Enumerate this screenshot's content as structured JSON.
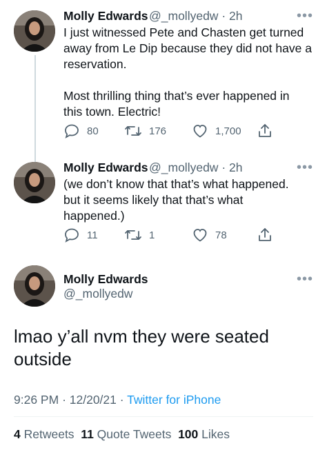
{
  "tweets": [
    {
      "name": "Molly Edwards",
      "handle": "@_mollyedw",
      "sep": "·",
      "time": "2h",
      "lines": [
        "I just witnessed Pete and Chasten get turned",
        "away from Le Dip because they did not have a",
        "reservation.",
        "",
        "Most thrilling thing that’s ever happened in",
        "this town. Electric!"
      ],
      "replies": "80",
      "retweets": "176",
      "likes": "1,700"
    },
    {
      "name": "Molly Edwards",
      "handle": "@_mollyedw",
      "sep": "·",
      "time": "2h",
      "lines": [
        "(we don’t know that that’s what happened.",
        "but it seems likely that that’s what",
        "happened.)"
      ],
      "replies": "11",
      "retweets": "1",
      "likes": "78"
    }
  ],
  "main": {
    "name": "Molly Edwards",
    "handle": "@_mollyedw",
    "lines": [
      "lmao y’all nvm they were seated",
      "outside"
    ],
    "time": "9:26 PM",
    "dot1": "·",
    "date": "12/20/21",
    "dot2": "·",
    "source": "Twitter for iPhone",
    "retweets_count": "4",
    "retweets_label": "Retweets",
    "quotes_count": "11",
    "quotes_label": "Quote Tweets",
    "likes_count": "100",
    "likes_label": "Likes"
  },
  "icons": {
    "more": "more-icon",
    "reply": "reply-icon",
    "retweet": "retweet-icon",
    "like": "heart-icon",
    "share": "share-icon"
  },
  "colors": {
    "text": "#0f1419",
    "secondary": "#536471",
    "link": "#1d9bf0",
    "line": "#cfd9de"
  }
}
